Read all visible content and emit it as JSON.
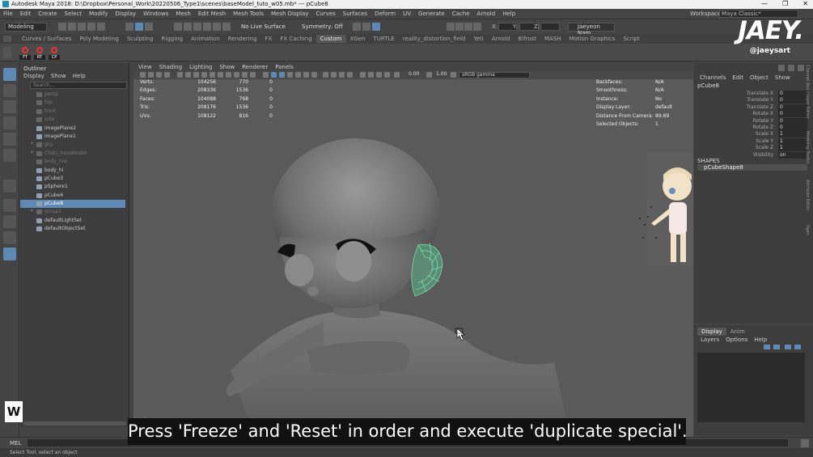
{
  "window": {
    "title": "Autodesk Maya 2018: D:\\Dropbox\\Personal_Work\\20220506_Type1\\scenes\\baseModel_tuto_w05.mb* --- pCube8",
    "controls": [
      "—",
      "❐",
      "✕"
    ]
  },
  "menubar": {
    "items": [
      "File",
      "Edit",
      "Create",
      "Select",
      "Modify",
      "Display",
      "Windows",
      "Mesh",
      "Edit Mesh",
      "Mesh Tools",
      "Mesh Display",
      "Curves",
      "Surfaces",
      "Deform",
      "UV",
      "Generate",
      "Cache",
      "Arnold",
      "Help"
    ],
    "workspace_label": "Workspace :",
    "workspace_value": "Maya Classic*"
  },
  "statusline": {
    "mode": "Modeling",
    "live_surface": "No Live Surface",
    "symmetry": "Symmetry: Off",
    "x_label": "X:",
    "y_label": "Y:",
    "z_label": "Z:",
    "user": "Jaeyeon Nam"
  },
  "shelf": {
    "tabs": [
      "Curves / Surfaces",
      "Poly Modeling",
      "Sculpting",
      "Rigging",
      "Animation",
      "Rendering",
      "FX",
      "FX Caching",
      "Custom",
      "XGen",
      "TURTLE",
      "reality_distortion_field",
      "Yeti",
      "Arnold",
      "Bifrost",
      "MASH",
      "Motion Graphics",
      "Script"
    ],
    "active_tab": "Custom",
    "buttons": [
      "FT",
      "RT",
      "CP"
    ]
  },
  "logo": {
    "name": "JAEY.",
    "handle": "@jaeysart"
  },
  "outliner": {
    "title": "Outliner",
    "menu": [
      "Display",
      "Show",
      "Help"
    ],
    "search_placeholder": "Search...",
    "items": [
      {
        "label": "persp",
        "dim": true,
        "expand": ""
      },
      {
        "label": "top",
        "dim": true,
        "expand": ""
      },
      {
        "label": "front",
        "dim": true,
        "expand": ""
      },
      {
        "label": "side",
        "dim": true,
        "expand": ""
      },
      {
        "label": "imagePlane2",
        "dim": false,
        "expand": ""
      },
      {
        "label": "imagePlane1",
        "dim": false,
        "expand": ""
      },
      {
        "label": "grp",
        "dim": true,
        "expand": "+"
      },
      {
        "label": "Chibs_baseModel",
        "dim": true,
        "expand": "+"
      },
      {
        "label": "body_low",
        "dim": true,
        "expand": ""
      },
      {
        "label": "body_hi",
        "dim": false,
        "expand": ""
      },
      {
        "label": "pCube3",
        "dim": false,
        "expand": ""
      },
      {
        "label": "pSphere1",
        "dim": false,
        "expand": ""
      },
      {
        "label": "pCube6",
        "dim": false,
        "expand": ""
      },
      {
        "label": "pCube8",
        "dim": false,
        "expand": "",
        "selected": true
      },
      {
        "label": "group1",
        "dim": true,
        "expand": "+"
      },
      {
        "label": "defaultLightSet",
        "dim": false,
        "expand": ""
      },
      {
        "label": "defaultObjectSet",
        "dim": false,
        "expand": ""
      }
    ]
  },
  "viewport": {
    "menu": [
      "View",
      "Shading",
      "Lighting",
      "Show",
      "Renderer",
      "Panels"
    ],
    "exposure": "0.00",
    "gamma": "1.00",
    "color_space": "sRGB gamma",
    "hud_left": [
      {
        "k": "Verts:",
        "a": "104256",
        "b": "770",
        "c": "0"
      },
      {
        "k": "Edges:",
        "a": "208336",
        "b": "1536",
        "c": "0"
      },
      {
        "k": "Faces:",
        "a": "104088",
        "b": "768",
        "c": "0"
      },
      {
        "k": "Tris:",
        "a": "208176",
        "b": "1536",
        "c": "0"
      },
      {
        "k": "UVs:",
        "a": "108122",
        "b": "816",
        "c": "0"
      }
    ],
    "hud_right": [
      {
        "k": "Backfaces:",
        "v": "N/A"
      },
      {
        "k": "Smoothness:",
        "v": "N/A"
      },
      {
        "k": "Instance:",
        "v": "No"
      },
      {
        "k": "Display Layer:",
        "v": "default"
      },
      {
        "k": "Distance From Camera:",
        "v": "89.89"
      },
      {
        "k": "Selected Objects:",
        "v": "1"
      }
    ]
  },
  "channelbox": {
    "menu": [
      "Channels",
      "Edit",
      "Object",
      "Show"
    ],
    "object": "pCube8",
    "attributes": [
      {
        "name": "Translate X",
        "value": "0"
      },
      {
        "name": "Translate Y",
        "value": "0"
      },
      {
        "name": "Translate Z",
        "value": "0"
      },
      {
        "name": "Rotate X",
        "value": "0"
      },
      {
        "name": "Rotate Y",
        "value": "0"
      },
      {
        "name": "Rotate Z",
        "value": "0"
      },
      {
        "name": "Scale X",
        "value": "1"
      },
      {
        "name": "Scale Y",
        "value": "1"
      },
      {
        "name": "Scale Z",
        "value": "1"
      },
      {
        "name": "Visibility",
        "value": "on"
      }
    ],
    "shapes_label": "SHAPES",
    "shape": "pCubeShape8",
    "side_tabs": [
      "Channel Box / Layer Editor",
      "Modeling Toolkit",
      "Attribute Editor",
      "Xgen"
    ]
  },
  "layer_editor": {
    "tabs": [
      "Display",
      "Anim"
    ],
    "active_tab": "Display",
    "menu": [
      "Layers",
      "Options",
      "Help"
    ]
  },
  "bottom": {
    "mel": "MEL",
    "help": "Select Tool: select an object"
  },
  "caption": "Press 'Freeze' and 'Reset' in order and execute 'duplicate special'.",
  "watermark": "W"
}
